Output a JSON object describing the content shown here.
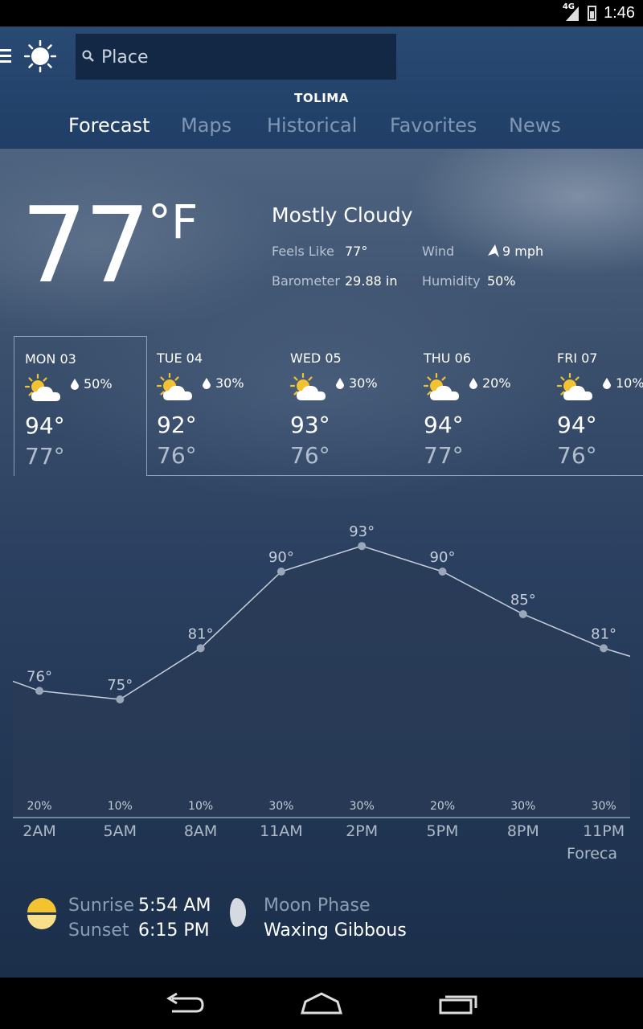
{
  "status_bar": {
    "network": "4G",
    "time": "1:46"
  },
  "search": {
    "placeholder": "Place"
  },
  "location": "TOLIMA",
  "tabs": [
    {
      "label": "Forecast",
      "active": true
    },
    {
      "label": "Maps",
      "active": false
    },
    {
      "label": "Historical",
      "active": false
    },
    {
      "label": "Favorites",
      "active": false
    },
    {
      "label": "News",
      "active": false
    }
  ],
  "current": {
    "temperature": "77",
    "unit": "°F",
    "condition": "Mostly Cloudy",
    "feels_like_label": "Feels Like",
    "feels_like": "77°",
    "wind_label": "Wind",
    "wind": "9 mph",
    "barometer_label": "Barometer",
    "barometer": "29.88 in",
    "humidity_label": "Humidity",
    "humidity": "50%"
  },
  "daily": [
    {
      "day": "MON 03",
      "precip": "50%",
      "high": "94°",
      "low": "77°",
      "icon": "partly-cloudy-sun-icon",
      "selected": true
    },
    {
      "day": "TUE 04",
      "precip": "30%",
      "high": "92°",
      "low": "76°",
      "icon": "partly-cloudy-sun-icon",
      "selected": false
    },
    {
      "day": "WED 05",
      "precip": "30%",
      "high": "93°",
      "low": "76°",
      "icon": "partly-cloudy-sun-icon",
      "selected": false
    },
    {
      "day": "THU 06",
      "precip": "20%",
      "high": "94°",
      "low": "77°",
      "icon": "partly-cloudy-sun-icon",
      "selected": false
    },
    {
      "day": "FRI 07",
      "precip": "10%",
      "high": "94°",
      "low": "76°",
      "icon": "partly-cloudy-sun-icon",
      "selected": false
    }
  ],
  "chart_data": {
    "type": "area",
    "categories": [
      "2AM",
      "5AM",
      "8AM",
      "11AM",
      "2PM",
      "5PM",
      "8PM",
      "11PM"
    ],
    "values": [
      76,
      75,
      81,
      90,
      93,
      90,
      85,
      81
    ],
    "labels": [
      "76°",
      "75°",
      "81°",
      "90°",
      "93°",
      "90°",
      "85°",
      "81°"
    ],
    "precip": [
      "20%",
      "10%",
      "10%",
      "30%",
      "30%",
      "20%",
      "30%",
      "30%"
    ],
    "ylim": [
      70,
      96
    ],
    "source": "Foreca",
    "colors": {
      "line": "#c7d0dc",
      "fill": "#2a3b55",
      "point": "#9aa7b8"
    }
  },
  "sun": {
    "sunrise_label": "Sunrise",
    "sunrise": "5:54 AM",
    "sunset_label": "Sunset",
    "sunset": "6:15 PM",
    "icon": "sunrise-sunset-icon"
  },
  "moon": {
    "label": "Moon Phase",
    "phase": "Waxing Gibbous",
    "icon": "moon-phase-icon"
  },
  "nav": {
    "buttons": [
      "back",
      "home",
      "recents"
    ]
  }
}
